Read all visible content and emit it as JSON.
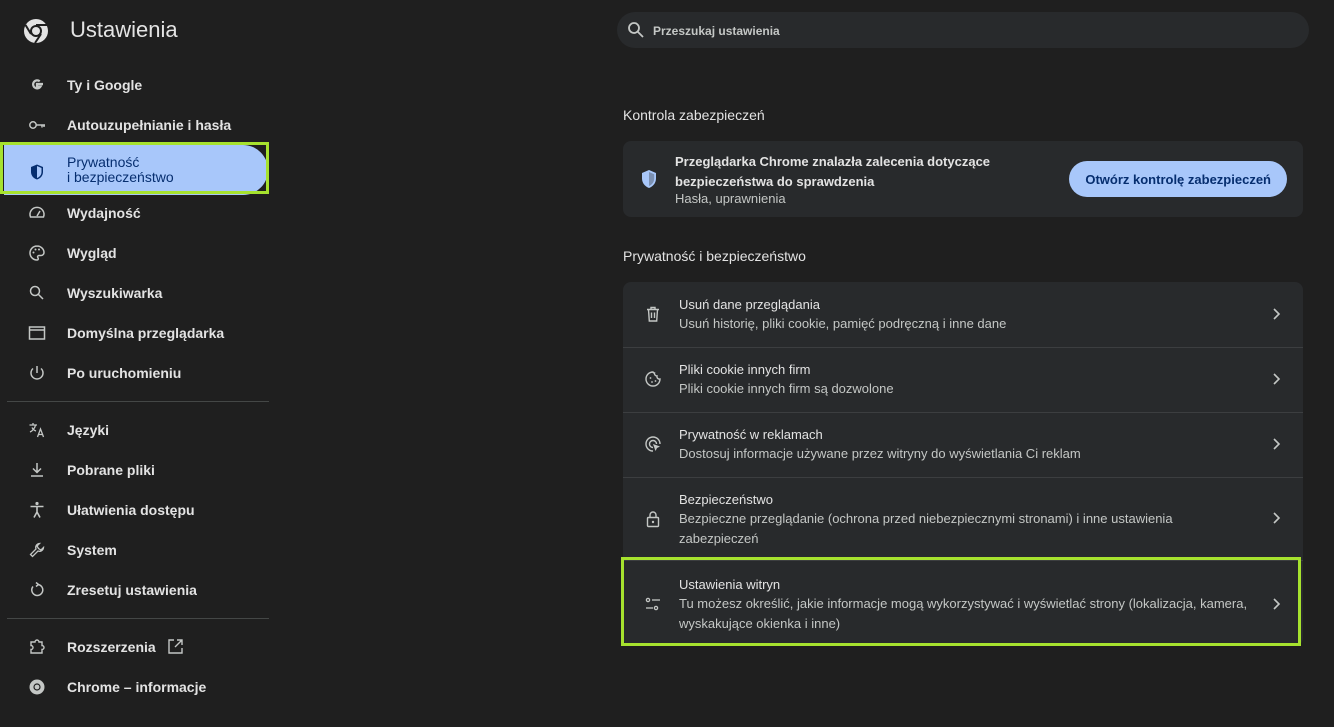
{
  "header": {
    "title": "Ustawienia",
    "logo_icon": "chrome-logo-icon"
  },
  "search": {
    "placeholder": "Przeszukaj ustawienia",
    "icon": "search-icon"
  },
  "sidebar": {
    "items": [
      {
        "label": "Ty i Google",
        "icon": "google-g-icon"
      },
      {
        "label": "Autouzupełnianie i hasła",
        "icon": "key-icon"
      },
      {
        "label": "Prywatność\ni bezpieczeństwo",
        "icon": "shield-icon",
        "active": true
      },
      {
        "label": "Wydajność",
        "icon": "speedometer-icon"
      },
      {
        "label": "Wygląd",
        "icon": "palette-icon"
      },
      {
        "label": "Wyszukiwarka",
        "icon": "search-icon"
      },
      {
        "label": "Domyślna przeglądarka",
        "icon": "browser-window-icon"
      },
      {
        "label": "Po uruchomieniu",
        "icon": "power-icon"
      },
      {
        "label": "Języki",
        "icon": "translate-icon"
      },
      {
        "label": "Pobrane pliki",
        "icon": "download-icon"
      },
      {
        "label": "Ułatwienia dostępu",
        "icon": "accessibility-icon"
      },
      {
        "label": "System",
        "icon": "wrench-icon"
      },
      {
        "label": "Zresetuj ustawienia",
        "icon": "reset-icon"
      },
      {
        "label": "Rozszerzenia",
        "icon": "puzzle-icon",
        "external_icon": "open-in-new-icon"
      },
      {
        "label": "Chrome – informacje",
        "icon": "chrome-logo-icon"
      }
    ]
  },
  "safety_check": {
    "section_title": "Kontrola zabezpieczeń",
    "line1": "Przeglądarka Chrome znalazła zalecenia dotyczące bezpieczeństwa do sprawdzenia",
    "subtitle": "Hasła, uprawnienia",
    "button_label": "Otwórz kontrolę zabezpieczeń",
    "icon": "shield-check-icon"
  },
  "privacy": {
    "section_title": "Prywatność i bezpieczeństwo",
    "rows": [
      {
        "title": "Usuń dane przeglądania",
        "subtitle": "Usuń historię, pliki cookie, pamięć podręczną i inne dane",
        "icon": "trash-icon"
      },
      {
        "title": "Pliki cookie innych firm",
        "subtitle": "Pliki cookie innych firm są dozwolone",
        "icon": "cookie-icon"
      },
      {
        "title": "Prywatność w reklamach",
        "subtitle": "Dostosuj informacje używane przez witryny do wyświetlania Ci reklam",
        "icon": "ad-privacy-icon"
      },
      {
        "title": "Bezpieczeństwo",
        "subtitle": "Bezpieczne przeglądanie (ochrona przed niebezpiecznymi stronami) i inne ustawienia zabezpieczeń",
        "icon": "lock-icon"
      },
      {
        "title": "Ustawienia witryn",
        "subtitle": "Tu możesz określić, jakie informacje mogą wykorzystywać i wyświetlać strony (lokalizacja, kamera, wyskakujące okienka i inne)",
        "icon": "tune-icon"
      }
    ]
  },
  "colors": {
    "background": "#1f1f1f",
    "card": "#282a2c",
    "accent": "#a8c7fa",
    "highlight": "#a6e22e"
  }
}
